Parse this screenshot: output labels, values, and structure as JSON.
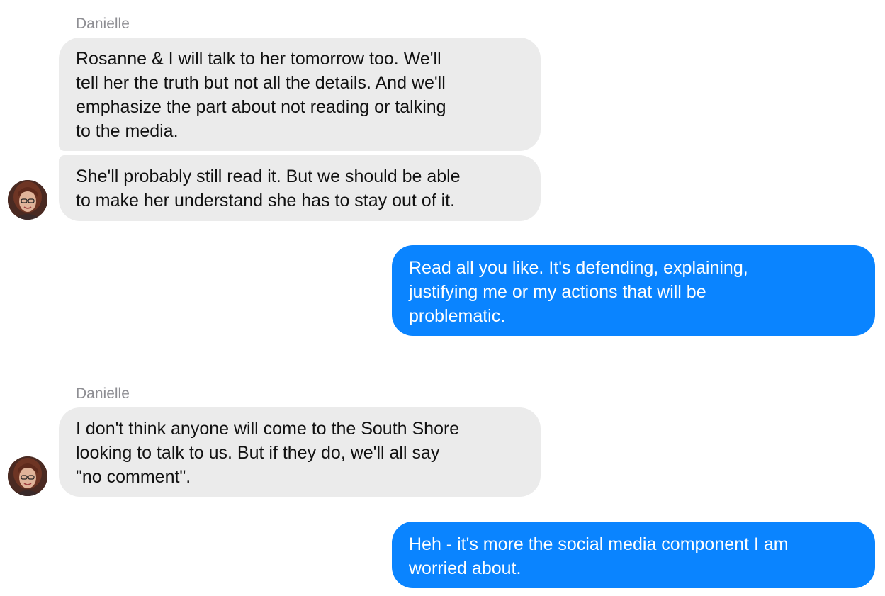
{
  "conversation": {
    "groups": [
      {
        "sender": "Danielle",
        "messages": [
          "Rosanne & I will talk to her tomorrow too. We'll\ntell her the truth but not all the details. And we'll\nemphasize the part about not reading or talking\nto the media.",
          "She'll probably still read it. But we should be able\nto make her understand she has to stay out of it."
        ]
      },
      {
        "sender": "me",
        "messages": [
          "Read all you like.  It's defending, explaining,\njustifying me or my actions that will be\nproblematic."
        ]
      },
      {
        "sender": "Danielle",
        "messages": [
          "I don't think anyone will come to the South Shore\nlooking to talk to us. But if they do, we'll all say\n\"no comment\"."
        ]
      },
      {
        "sender": "me",
        "messages": [
          "Heh - it's more the social media component I am\nworried about."
        ]
      }
    ]
  },
  "colors": {
    "incoming_bubble": "#ebebeb",
    "outgoing_bubble": "#0a84ff",
    "sender_name": "#8e8e93"
  },
  "icons": {
    "contact_avatar": "avatar-photo"
  }
}
